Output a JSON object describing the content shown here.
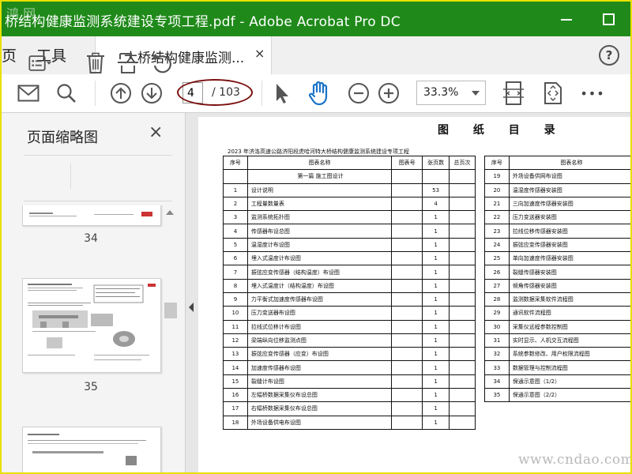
{
  "window": {
    "title": "桥结构健康监测系统建设专项工程.pdf - Adobe Acrobat Pro DC",
    "watermark_top": "鸿 网"
  },
  "menubar": {
    "home_partial": "页",
    "tools": "工具",
    "doc_tab": "大桥结构健康监测...",
    "doc_tab_close": "×",
    "help": "?"
  },
  "toolbar": {
    "page_current": "4",
    "page_total": "/ 103",
    "zoom": "33.3%",
    "more": "•••"
  },
  "panel": {
    "title": "页面缩略图",
    "close": "×",
    "thumbs": [
      {
        "page": "34"
      },
      {
        "page": "35"
      }
    ]
  },
  "document": {
    "title": "图 纸 目 录",
    "subtitle": "2023 年济洛高速公路济阳段虎哈河特大桥结构健康监测系统建设专项工程",
    "left_headers": [
      "序号",
      "图表名称",
      "图表号",
      "张页数",
      "总页次"
    ],
    "left_rows": [
      [
        "",
        "第一篇  施工图设计",
        "",
        "",
        ""
      ],
      [
        "1",
        "设计说明",
        "",
        "53",
        ""
      ],
      [
        "2",
        "工程量数量表",
        "",
        "4",
        ""
      ],
      [
        "3",
        "监测系统拓扑图",
        "",
        "1",
        ""
      ],
      [
        "4",
        "传感器布设总图",
        "",
        "1",
        ""
      ],
      [
        "5",
        "温湿度计布设图",
        "",
        "1",
        ""
      ],
      [
        "6",
        "埋入式温度计布设图",
        "",
        "1",
        ""
      ],
      [
        "7",
        "振弦应变传感器（结构温度）布设图",
        "",
        "1",
        ""
      ],
      [
        "8",
        "埋入式温度计（结构温度）布设图",
        "",
        "1",
        ""
      ],
      [
        "9",
        "力平衡式加速度传感器布设图",
        "",
        "1",
        ""
      ],
      [
        "10",
        "压力变送器布设图",
        "",
        "1",
        ""
      ],
      [
        "11",
        "拉线式位移计布设图",
        "",
        "1",
        ""
      ],
      [
        "12",
        "梁端纵向位移监测点图",
        "",
        "1",
        ""
      ],
      [
        "13",
        "振弦应变传感器（应变）布设图",
        "",
        "1",
        ""
      ],
      [
        "14",
        "加速度传感器布设图",
        "",
        "1",
        ""
      ],
      [
        "15",
        "裂缝计布设图",
        "",
        "1",
        ""
      ],
      [
        "16",
        "左幅桥数据采集仪布设总图",
        "",
        "1",
        ""
      ],
      [
        "17",
        "右幅桥数据采集仪布设总图",
        "",
        "1",
        ""
      ],
      [
        "18",
        "外场设备供电布设图",
        "",
        "1",
        ""
      ]
    ],
    "right_headers": [
      "序号",
      "图表名称"
    ],
    "right_rows": [
      [
        "19",
        "外场设备供网布设图"
      ],
      [
        "20",
        "温湿度传感器安装图"
      ],
      [
        "21",
        "三向加速度传感器安装图"
      ],
      [
        "22",
        "压力变送器安装图"
      ],
      [
        "23",
        "拉线位移传感器安装图"
      ],
      [
        "24",
        "振弦应变传感器安装图"
      ],
      [
        "25",
        "单向加速度传感器安装图"
      ],
      [
        "26",
        "裂缝传感器安装图"
      ],
      [
        "27",
        "倾角传感器安装图"
      ],
      [
        "28",
        "监测数据采集软件流程图"
      ],
      [
        "29",
        "通讯软件流程图"
      ],
      [
        "30",
        "采集仪远程参数控制图"
      ],
      [
        "31",
        "实时显示、人机交互流程图"
      ],
      [
        "32",
        "系统参数修改、用户权限流程图"
      ],
      [
        "33",
        "数据管理与控制流程图"
      ],
      [
        "34",
        "保通示意图（1/2）"
      ],
      [
        "35",
        "保通示意图（2/2）"
      ]
    ]
  },
  "watermark_bottom": "www.cndao.com",
  "colors": {
    "titlebar": "#1f8a1a",
    "frame": "#e8e000",
    "page_oval": "#7a1010"
  }
}
